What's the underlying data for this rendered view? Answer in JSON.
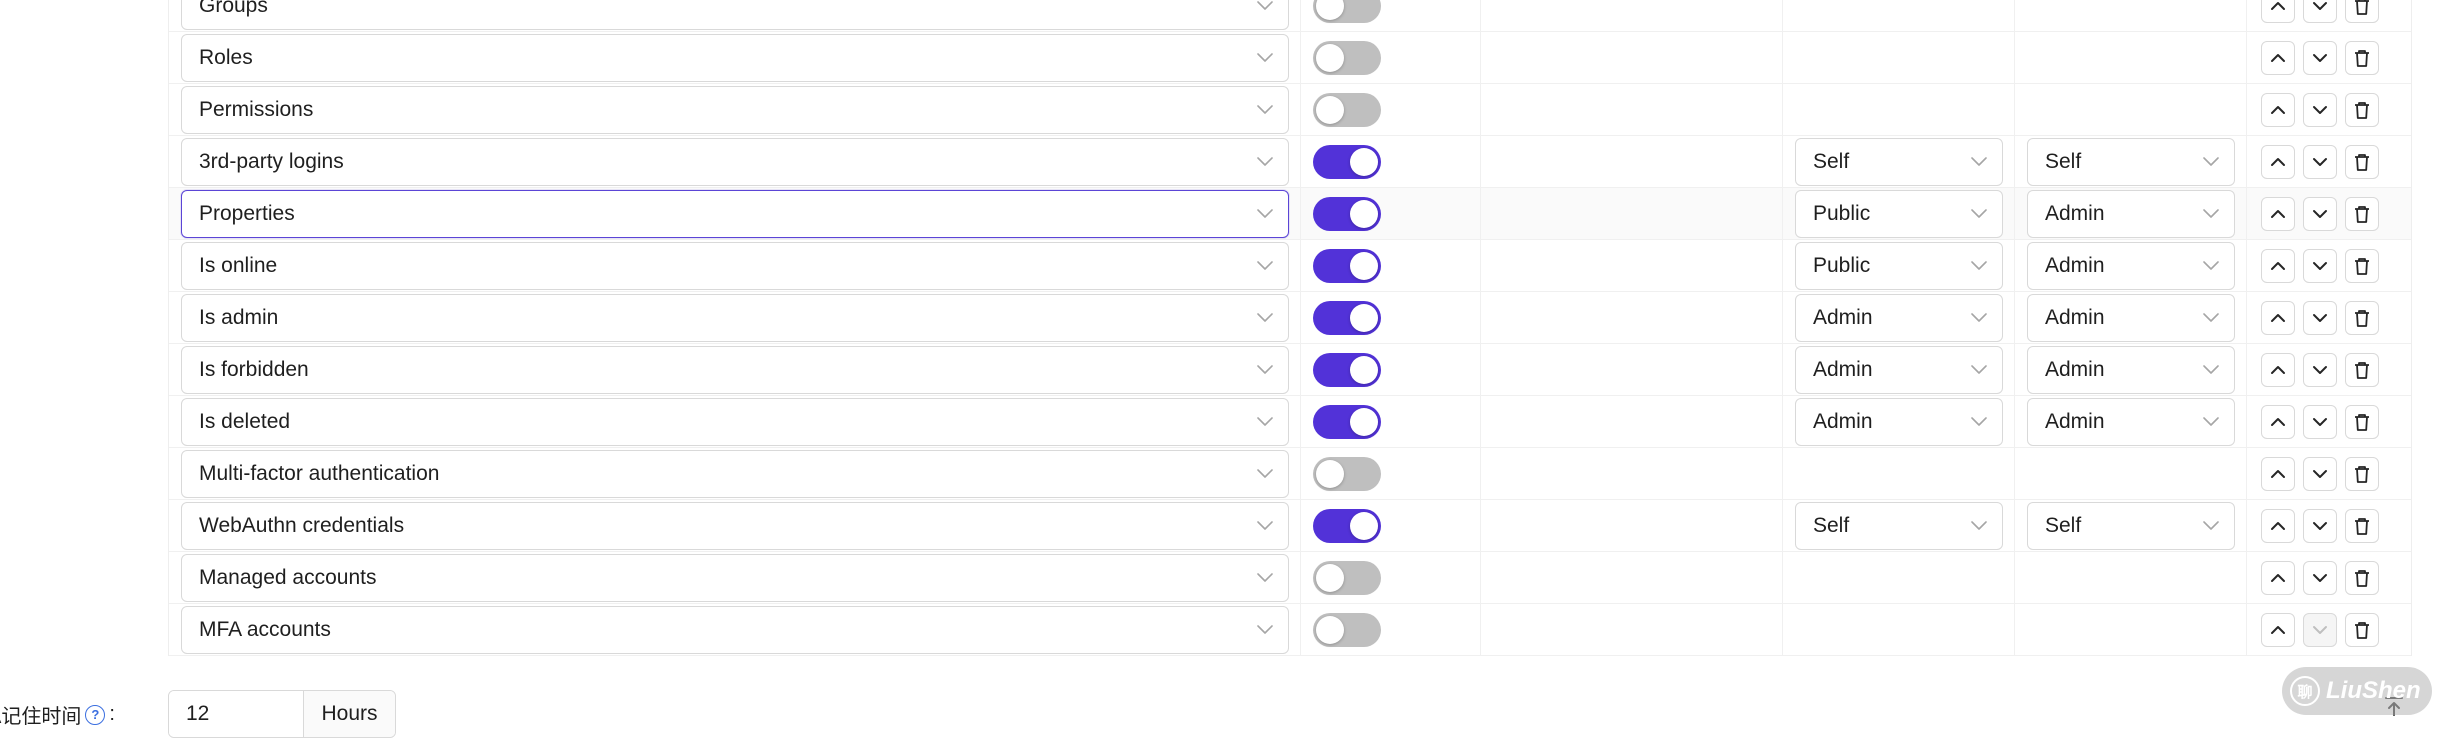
{
  "rows": [
    {
      "name": "Groups",
      "enabled": false,
      "view": "",
      "modify": "",
      "focused": false,
      "down_disabled": false
    },
    {
      "name": "Roles",
      "enabled": false,
      "view": "",
      "modify": "",
      "focused": false,
      "down_disabled": false
    },
    {
      "name": "Permissions",
      "enabled": false,
      "view": "",
      "modify": "",
      "focused": false,
      "down_disabled": false
    },
    {
      "name": "3rd-party logins",
      "enabled": true,
      "view": "Self",
      "modify": "Self",
      "focused": false,
      "down_disabled": false
    },
    {
      "name": "Properties",
      "enabled": true,
      "view": "Public",
      "modify": "Admin",
      "focused": true,
      "down_disabled": false
    },
    {
      "name": "Is online",
      "enabled": true,
      "view": "Public",
      "modify": "Admin",
      "focused": false,
      "down_disabled": false
    },
    {
      "name": "Is admin",
      "enabled": true,
      "view": "Admin",
      "modify": "Admin",
      "focused": false,
      "down_disabled": false
    },
    {
      "name": "Is forbidden",
      "enabled": true,
      "view": "Admin",
      "modify": "Admin",
      "focused": false,
      "down_disabled": false
    },
    {
      "name": "Is deleted",
      "enabled": true,
      "view": "Admin",
      "modify": "Admin",
      "focused": false,
      "down_disabled": false
    },
    {
      "name": "Multi-factor authentication",
      "enabled": false,
      "view": "",
      "modify": "",
      "focused": false,
      "down_disabled": false
    },
    {
      "name": "WebAuthn credentials",
      "enabled": true,
      "view": "Self",
      "modify": "Self",
      "focused": false,
      "down_disabled": false
    },
    {
      "name": "Managed accounts",
      "enabled": false,
      "view": "",
      "modify": "",
      "focused": false,
      "down_disabled": false
    },
    {
      "name": "MFA accounts",
      "enabled": false,
      "view": "",
      "modify": "",
      "focused": false,
      "down_disabled": true
    }
  ],
  "bottom": {
    "label": "A记住时间",
    "help_glyph": "?",
    "colon": ":",
    "value": "12",
    "unit": "Hours"
  },
  "watermark": {
    "text": "LiuShen",
    "glyph": "聊"
  },
  "colors": {
    "accent": "#5232d8",
    "focus_border": "#5b45d6",
    "switch_off": "#bfbfbf"
  },
  "icons": {
    "select_arrow": "chevron-down-icon",
    "move_up": "chevron-up-icon",
    "move_down": "chevron-down-icon",
    "delete": "trash-icon",
    "help": "question-circle-icon",
    "back_to_top": "arrow-up-icon"
  }
}
